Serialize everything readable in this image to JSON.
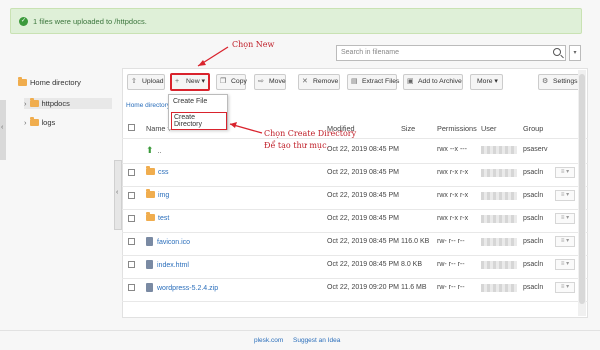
{
  "alert": {
    "message": "1 files were uploaded to /httpdocs."
  },
  "search": {
    "placeholder": "Search in filename"
  },
  "sidebar": {
    "home": "Home directory",
    "items": [
      {
        "label": "httpdocs"
      },
      {
        "label": "logs"
      }
    ]
  },
  "toolbar": {
    "upload": "Upload",
    "new": "New",
    "copy": "Copy",
    "move": "Move",
    "remove": "Remove",
    "extract": "Extract Files",
    "archive": "Add to Archive",
    "more": "More",
    "settings": "Settings"
  },
  "breadcrumb": "Home directory",
  "new_menu": {
    "items": [
      "Create File",
      "Create Directory"
    ]
  },
  "columns": {
    "name": "Name",
    "modified": "Modified",
    "size": "Size",
    "permissions": "Permissions",
    "user": "User",
    "group": "Group"
  },
  "files": [
    {
      "name": "..",
      "type": "up",
      "modified": "Oct 22, 2019 08:45 PM",
      "size": "",
      "permissions": "rwx --x ---",
      "group": "psaserv"
    },
    {
      "name": "css",
      "type": "folder",
      "modified": "Oct 22, 2019 08:45 PM",
      "size": "",
      "permissions": "rwx r-x r-x",
      "group": "psacln"
    },
    {
      "name": "img",
      "type": "folder",
      "modified": "Oct 22, 2019 08:45 PM",
      "size": "",
      "permissions": "rwx r-x r-x",
      "group": "psacln"
    },
    {
      "name": "test",
      "type": "folder",
      "modified": "Oct 22, 2019 08:45 PM",
      "size": "",
      "permissions": "rwx r-x r-x",
      "group": "psacln"
    },
    {
      "name": "favicon.ico",
      "type": "file",
      "modified": "Oct 22, 2019 08:45 PM",
      "size": "116.0 KB",
      "permissions": "rw- r-- r--",
      "group": "psacln"
    },
    {
      "name": "index.html",
      "type": "file",
      "modified": "Oct 22, 2019 08:45 PM",
      "size": "8.0 KB",
      "permissions": "rw- r-- r--",
      "group": "psacln"
    },
    {
      "name": "wordpress-5.2.4.zip",
      "type": "file",
      "modified": "Oct 22, 2019 09:20 PM",
      "size": "11.6 MB",
      "permissions": "rw- r-- r--",
      "group": "psacln"
    }
  ],
  "annotations": {
    "new": "Chọn New",
    "create_dir_1": "Chọn Create Directory",
    "create_dir_2": "Để tạo thư mục."
  },
  "footer": {
    "link1": "plesk.com",
    "link2": "Suggest an Idea"
  },
  "colors": {
    "annotation": "#d9232d",
    "link": "#2a6ebb",
    "folder": "#f0ad4e",
    "success_bg": "#dff0d8"
  }
}
